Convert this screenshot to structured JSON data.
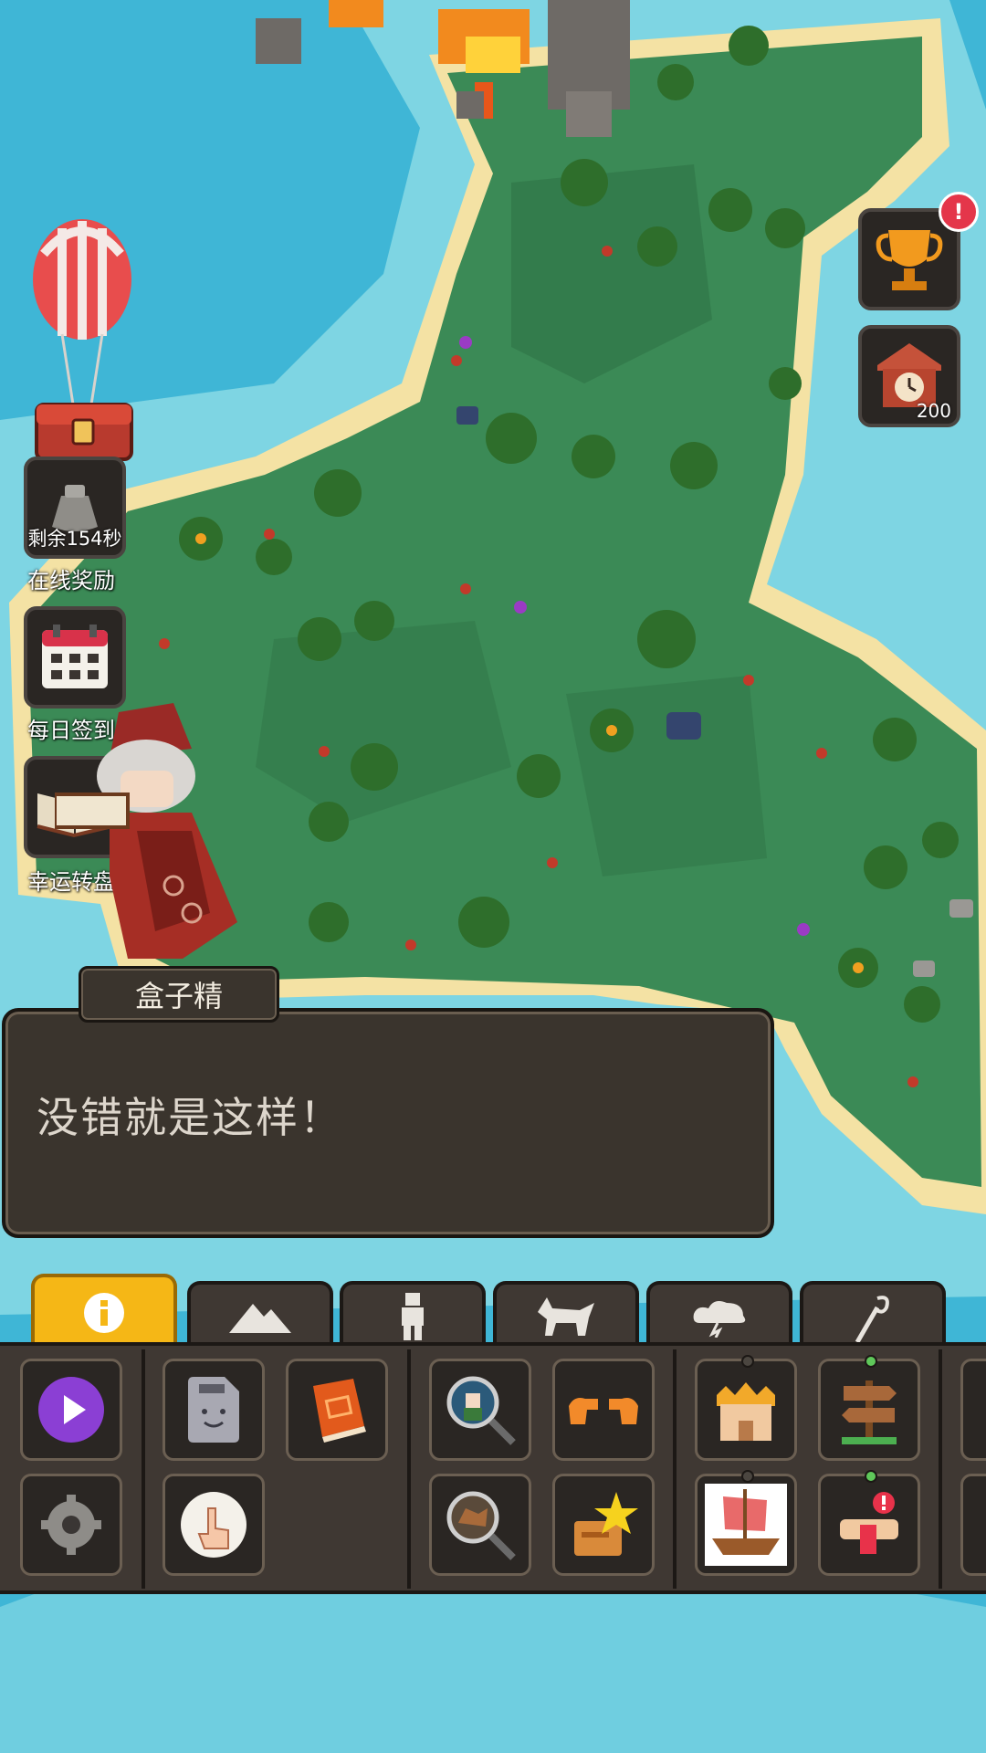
{
  "colors": {
    "ocean": "#3fb6d6",
    "shallow": "#8fdde6",
    "grass": "#3b8a56",
    "grass_dark": "#2f7346",
    "sand": "#f4e2a4",
    "panel": "#3f3833",
    "tab_active": "#f5b716"
  },
  "side": {
    "balloon_chest": {
      "icon": "balloon-chest-icon"
    },
    "online_reward": {
      "timer": "剩余154秒",
      "label": "在线奖励",
      "icon": "money-bag-icon"
    },
    "daily_signin": {
      "label": "每日签到",
      "icon": "calendar-icon"
    },
    "lucky_wheel": {
      "label": "幸运转盘",
      "icon": "spellbook-icon"
    },
    "trophy": {
      "icon": "trophy-icon",
      "badge": "!"
    },
    "clock": {
      "icon": "clock-icon",
      "count": "200"
    }
  },
  "dialog": {
    "speaker": "盒子精",
    "text": "没错就是这样！"
  },
  "tabs": [
    {
      "icon": "info-icon",
      "active": true
    },
    {
      "icon": "mountain-icon"
    },
    {
      "icon": "human-icon"
    },
    {
      "icon": "wolf-icon"
    },
    {
      "icon": "storm-cloud-icon"
    },
    {
      "icon": "magic-staff-icon"
    }
  ],
  "tools": [
    {
      "icon": "play-icon"
    },
    {
      "icon": "settings-gear-icon"
    },
    {
      "icon": "save-file-icon"
    },
    {
      "icon": "pointer-hand-icon"
    },
    {
      "icon": "encyclopedia-book-icon"
    },
    {
      "icon": "inspect-unit-icon"
    },
    {
      "icon": "inspect-animal-icon"
    },
    {
      "icon": "diplomacy-hands-icon"
    },
    {
      "icon": "favorites-star-icon"
    },
    {
      "icon": "kingdom-castle-icon"
    },
    {
      "icon": "ship-icon"
    },
    {
      "icon": "signpost-icon"
    },
    {
      "icon": "scroll-alert-icon"
    }
  ]
}
